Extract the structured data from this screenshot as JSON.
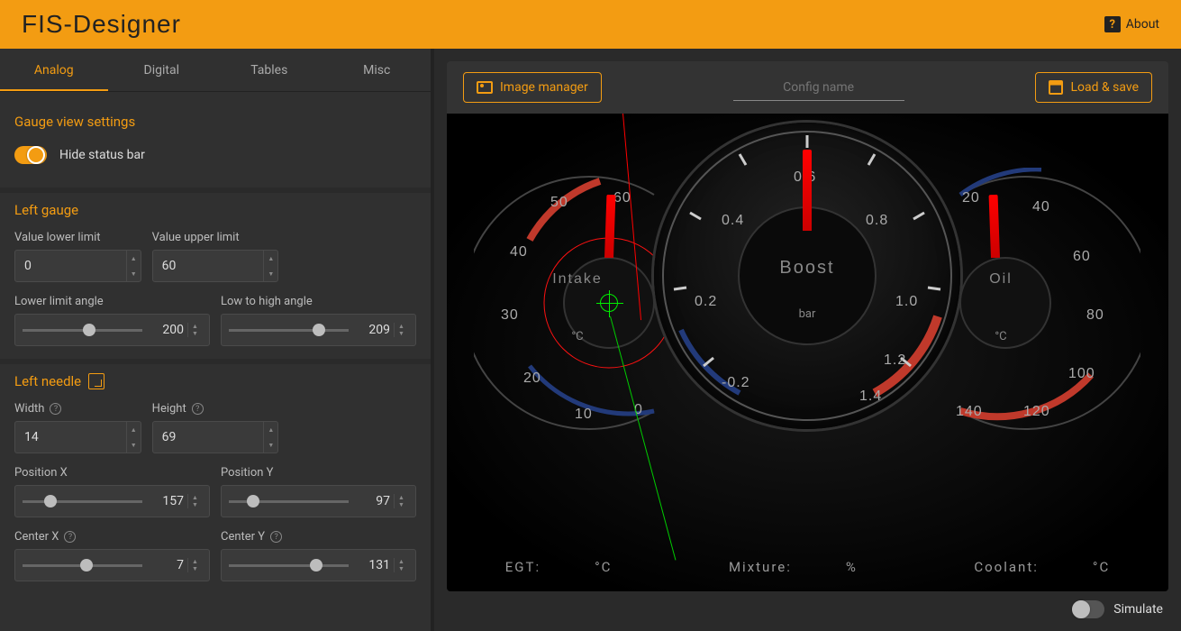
{
  "app": {
    "title": "FIS-Designer",
    "about": "About"
  },
  "tabs": [
    "Analog",
    "Digital",
    "Tables",
    "Misc"
  ],
  "active_tab": 0,
  "sections": {
    "gauge_view": {
      "title": "Gauge view settings",
      "hide_status_bar_label": "Hide status bar",
      "hide_status_bar": true
    },
    "left_gauge": {
      "title": "Left gauge",
      "value_lower_label": "Value lower limit",
      "value_lower": "0",
      "value_upper_label": "Value upper limit",
      "value_upper": "60",
      "lower_angle_label": "Lower limit angle",
      "lower_angle": "200",
      "low_high_label": "Low to high angle",
      "low_high": "209"
    },
    "left_needle": {
      "title": "Left needle",
      "width_label": "Width",
      "width": "14",
      "height_label": "Height",
      "height": "69",
      "posx_label": "Position X",
      "posx": "157",
      "posy_label": "Position Y",
      "posy": "97",
      "centerx_label": "Center X",
      "centerx": "7",
      "centery_label": "Center Y",
      "centery": "131"
    }
  },
  "toolbar": {
    "image_manager": "Image manager",
    "config_placeholder": "Config name",
    "load_save": "Load & save"
  },
  "gauges": {
    "left": {
      "label": "Intake",
      "unit": "°C",
      "ticks": [
        "0",
        "10",
        "20",
        "30",
        "40",
        "50",
        "60"
      ]
    },
    "center": {
      "label": "Boost",
      "unit": "bar",
      "ticks": [
        "-0.2",
        "0.2",
        "0.4",
        "0.6",
        "0.8",
        "1.0",
        "1.2",
        "1.4"
      ]
    },
    "right": {
      "label": "Oil",
      "unit": "°C",
      "ticks": [
        "20",
        "40",
        "60",
        "80",
        "100",
        "120",
        "140"
      ]
    }
  },
  "bottom": {
    "egt_label": "EGT:",
    "egt_unit": "°C",
    "mixture_label": "Mixture:",
    "mixture_unit": "%",
    "coolant_label": "Coolant:",
    "coolant_unit": "°C"
  },
  "simulate": {
    "label": "Simulate",
    "value": false
  }
}
